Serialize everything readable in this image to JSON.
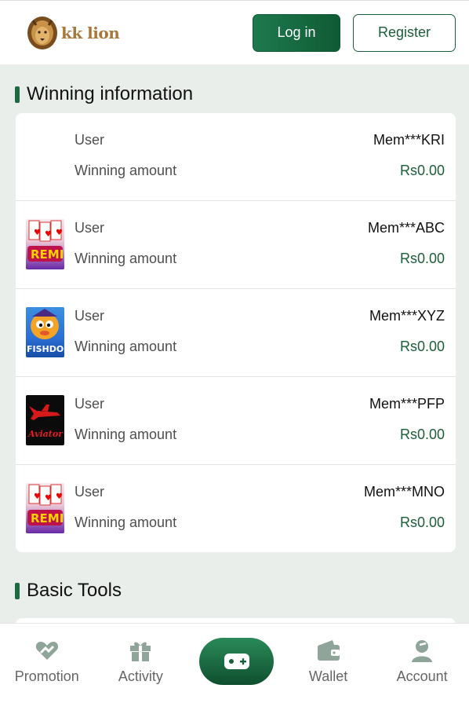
{
  "header": {
    "logo_text": "kk lion",
    "login_label": "Log in",
    "register_label": "Register"
  },
  "winning": {
    "title": "Winning information",
    "user_label": "User",
    "amount_label": "Winning amount",
    "rows": [
      {
        "user": "Mem***KRI",
        "amount": "Rs0.00",
        "game": "none"
      },
      {
        "user": "Mem***ABC",
        "amount": "Rs0.00",
        "game": "remi"
      },
      {
        "user": "Mem***XYZ",
        "amount": "Rs0.00",
        "game": "fishdom"
      },
      {
        "user": "Mem***PFP",
        "amount": "Rs0.00",
        "game": "aviator"
      },
      {
        "user": "Mem***MNO",
        "amount": "Rs0.00",
        "game": "remi"
      }
    ]
  },
  "tools": {
    "title": "Basic Tools"
  },
  "nav": {
    "items": [
      {
        "label": "Promotion",
        "icon": "heart-hand-icon"
      },
      {
        "label": "Activity",
        "icon": "gift-icon"
      },
      {
        "label": "",
        "icon": "gamepad-icon"
      },
      {
        "label": "Wallet",
        "icon": "wallet-icon"
      },
      {
        "label": "Account",
        "icon": "user-icon"
      }
    ]
  },
  "colors": {
    "brand_green": "#1b5e3b",
    "accent_green": "#1e7a4e",
    "page_bg": "#e9eeeb"
  }
}
